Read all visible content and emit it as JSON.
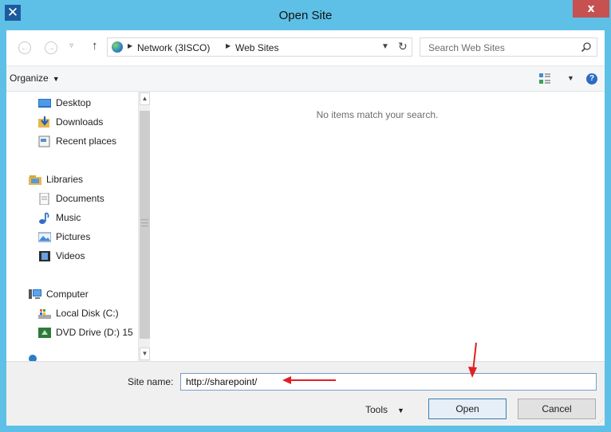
{
  "window": {
    "title": "Open Site",
    "close_glyph": "x"
  },
  "nav": {
    "back_glyph": "←",
    "forward_glyph": "→",
    "recent_glyph": "▿",
    "up_glyph": "↑",
    "breadcrumb": [
      "Network (3ISCO)",
      "Web Sites"
    ],
    "search_placeholder": "Search Web Sites"
  },
  "toolbar": {
    "organize_label": "Organize",
    "help_glyph": "?"
  },
  "navpane": {
    "favorites": [
      {
        "label": "Desktop",
        "icon": "desktop-icon"
      },
      {
        "label": "Downloads",
        "icon": "downloads-icon"
      },
      {
        "label": "Recent places",
        "icon": "recent-places-icon"
      }
    ],
    "libraries_label": "Libraries",
    "libraries": [
      {
        "label": "Documents",
        "icon": "documents-icon"
      },
      {
        "label": "Music",
        "icon": "music-icon"
      },
      {
        "label": "Pictures",
        "icon": "pictures-icon"
      },
      {
        "label": "Videos",
        "icon": "videos-icon"
      }
    ],
    "computer_label": "Computer",
    "computer": [
      {
        "label": "Local Disk (C:)",
        "icon": "local-disk-icon"
      },
      {
        "label": "DVD Drive (D:) 15",
        "icon": "dvd-drive-icon"
      }
    ]
  },
  "content": {
    "empty_message": "No items match your search."
  },
  "bottom": {
    "site_name_label": "Site name:",
    "site_name_value": "http://sharepoint/",
    "tools_label": "Tools",
    "open_label": "Open",
    "cancel_label": "Cancel"
  },
  "annotations": {
    "arrow_color": "#e02020"
  },
  "colors": {
    "titlebar": "#5ec0e6",
    "close": "#c75050",
    "accent": "#3c7fb1"
  }
}
